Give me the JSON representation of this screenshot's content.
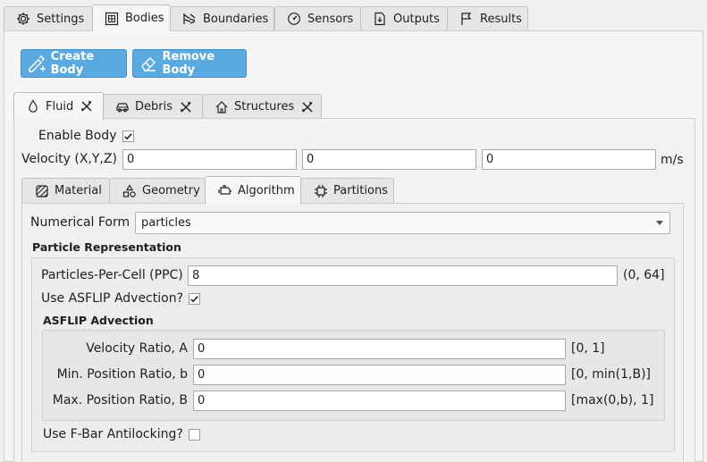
{
  "top_tabs": [
    {
      "label": "Settings",
      "icon": "gear-icon"
    },
    {
      "label": "Bodies",
      "icon": "grid-icon"
    },
    {
      "label": "Boundaries",
      "icon": "wave-icon"
    },
    {
      "label": "Sensors",
      "icon": "gauge-icon"
    },
    {
      "label": "Outputs",
      "icon": "file-output-icon"
    },
    {
      "label": "Results",
      "icon": "flag-icon"
    }
  ],
  "active_top_tab": "Bodies",
  "toolbar": {
    "create_label": "Create Body",
    "remove_label": "Remove Body"
  },
  "colors": {
    "accent": "#5aa9e0"
  },
  "body_tabs": [
    {
      "label": "Fluid",
      "icon": "droplet-icon"
    },
    {
      "label": "Debris",
      "icon": "car-icon"
    },
    {
      "label": "Structures",
      "icon": "house-icon"
    }
  ],
  "active_body_tab": "Fluid",
  "body": {
    "enable_label": "Enable Body",
    "enable_checked": true,
    "velocity_label": "Velocity (X,Y,Z)",
    "velocity_x": "0",
    "velocity_y": "0",
    "velocity_z": "0",
    "velocity_unit": "m/s"
  },
  "inner_tabs": [
    {
      "label": "Material",
      "icon": "material-icon"
    },
    {
      "label": "Geometry",
      "icon": "shapes-icon"
    },
    {
      "label": "Algorithm",
      "icon": "engine-icon"
    },
    {
      "label": "Partitions",
      "icon": "chip-icon"
    }
  ],
  "active_inner_tab": "Algorithm",
  "algorithm": {
    "numerical_form_label": "Numerical Form",
    "numerical_form_value": "particles",
    "particle_group_title": "Particle Representation",
    "ppc_label": "Particles-Per-Cell (PPC)",
    "ppc_value": "8",
    "ppc_range": "(0, 64]",
    "asflip_toggle_label": "Use ASFLIP Advection?",
    "asflip_checked": true,
    "asflip_group_title": "ASFLIP Advection",
    "velocity_ratio_label": "Velocity Ratio, A",
    "velocity_ratio_value": "0",
    "velocity_ratio_range": "[0, 1]",
    "min_pos_label": "Min. Position Ratio, b",
    "min_pos_value": "0",
    "min_pos_range": "[0, min(1,B)]",
    "max_pos_label": "Max. Position Ratio, B",
    "max_pos_value": "0",
    "max_pos_range": "[max(0,b), 1]",
    "fbar_label": "Use F-Bar Antilocking?",
    "fbar_checked": false
  }
}
